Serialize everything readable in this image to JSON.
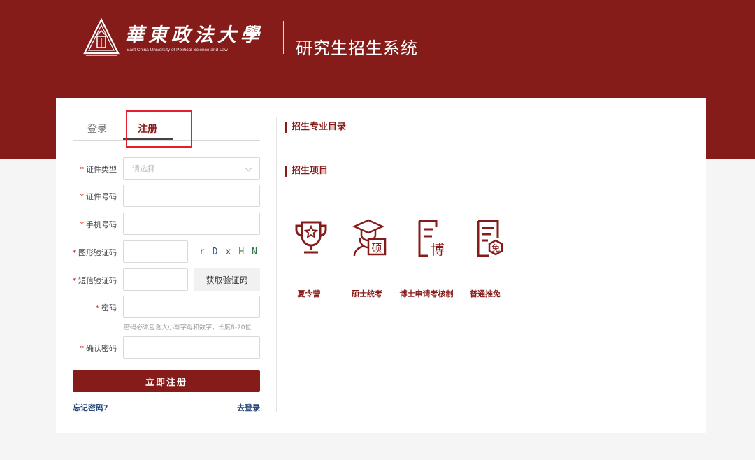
{
  "header": {
    "university_cn": "華東政法大學",
    "university_en": "East China University of Political Science and Law",
    "system_title": "研究生招生系统"
  },
  "tabs": {
    "login": "登录",
    "register": "注册",
    "active": "register"
  },
  "form": {
    "id_type": {
      "label": "证件类型",
      "placeholder": "请选择"
    },
    "id_number": {
      "label": "证件号码",
      "value": ""
    },
    "phone": {
      "label": "手机号码",
      "value": ""
    },
    "captcha": {
      "label": "图形验证码",
      "value": "",
      "image_text": [
        "r",
        "D",
        "x",
        "H",
        "N"
      ]
    },
    "sms_code": {
      "label": "短信验证码",
      "value": "",
      "button": "获取验证码"
    },
    "password": {
      "label": "密码",
      "value": "",
      "hint": "密码必须包含大小写字母和数字，长度8-20位"
    },
    "confirm_password": {
      "label": "确认密码",
      "value": ""
    },
    "required_mark": "*",
    "submit": "立即注册",
    "forgot": "忘记密码?",
    "go_login": "去登录"
  },
  "sections": {
    "catalog": "招生专业目录",
    "programs": "招生项目"
  },
  "programs": [
    {
      "label": "夏令营",
      "icon": "trophy-icon"
    },
    {
      "label": "硕士统考",
      "icon": "graduate-icon"
    },
    {
      "label": "博士申请考核制",
      "icon": "document-bo-icon"
    },
    {
      "label": "普通推免",
      "icon": "document-mian-icon"
    }
  ],
  "colors": {
    "brand": "#861c1a",
    "highlight": "#e41f2c",
    "link": "#2a4a7a"
  }
}
